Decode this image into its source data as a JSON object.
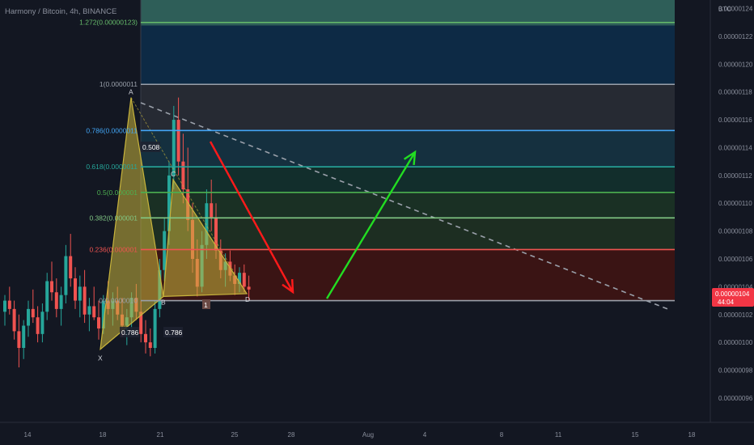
{
  "header": {
    "title": "Harmony / Bitcoin, 4h, BINANCE"
  },
  "price_axis": {
    "currency": "BTC",
    "last_price": "0.00000104",
    "countdown": "44:04",
    "last_price_color": "#f23645"
  },
  "colors": {
    "background": "#131722",
    "bull_candle": "#26a69a",
    "bear_candle": "#ef5350",
    "pattern_fill": "#c8b43c",
    "trendline": "#9aa0aa",
    "down_arrow": "#ff1a1a",
    "up_arrow": "#22dd22"
  },
  "chart_data": {
    "type": "candlestick",
    "title": "Harmony / Bitcoin, 4h, BINANCE",
    "y_unit": "BTC",
    "ylim": [
      9.52e-07,
      1.254e-06
    ],
    "x_ticks": [
      "14",
      "18",
      "21",
      "25",
      "28",
      "Aug",
      "4",
      "8",
      "11",
      "15",
      "18"
    ],
    "y_ticks": [
      "0.00000124",
      "0.00000122",
      "0.00000120",
      "0.00000118",
      "0.00000116",
      "0.00000114",
      "0.00000112",
      "0.00000110",
      "0.00000108",
      "0.00000106",
      "0.00000104",
      "0.00000102",
      "0.00000100",
      "0.00000098",
      "0.00000096"
    ],
    "fib_levels": [
      {
        "ratio": 1.272,
        "label": "1.272(0.00000123)",
        "price": 1.23e-06,
        "color": "#66bb6a"
      },
      {
        "ratio": 1,
        "label": "1(0.0000011",
        "price": 1.1855e-06,
        "color": "#9aa0aa"
      },
      {
        "ratio": 0.786,
        "label": "0.786(0.0000011",
        "price": 1.1523e-06,
        "color": "#42a5f5"
      },
      {
        "ratio": 0.618,
        "label": "0.618(0.0000011",
        "price": 1.1262e-06,
        "color": "#26a69a"
      },
      {
        "ratio": 0.5,
        "label": "0.5(0.000001",
        "price": 1.1078e-06,
        "color": "#4caf50"
      },
      {
        "ratio": 0.382,
        "label": "0.382(0.000001",
        "price": 1.0895e-06,
        "color": "#81c784"
      },
      {
        "ratio": 0.236,
        "label": "0.236(0.000001",
        "price": 1.0667e-06,
        "color": "#ef5350"
      },
      {
        "ratio": 0,
        "label": "0(0.0000010",
        "price": 1.03e-06,
        "color": "#9aa0aa"
      }
    ],
    "fib_zones": [
      {
        "from": 1.272,
        "to": 1.4,
        "color": "#2e5e58"
      },
      {
        "from": 1,
        "to": 1.272,
        "color": "#0d2a45"
      },
      {
        "from": 0.786,
        "to": 1,
        "color": "#262a33"
      },
      {
        "from": 0.618,
        "to": 0.786,
        "color": "#15303f"
      },
      {
        "from": 0.5,
        "to": 0.618,
        "color": "#122e2c"
      },
      {
        "from": 0.382,
        "to": 0.5,
        "color": "#1a3024"
      },
      {
        "from": 0.236,
        "to": 0.382,
        "color": "#1d2e22"
      },
      {
        "from": 0,
        "to": 0.236,
        "color": "#3a1414"
      }
    ],
    "harmonic_pattern": {
      "points": [
        {
          "name": "X",
          "price": 9.95e-07
        },
        {
          "name": "A",
          "price": 1.176e-06
        },
        {
          "name": "B",
          "price": 1.033e-06
        },
        {
          "name": "C",
          "price": 1.117e-06
        },
        {
          "name": "D",
          "price": 1.035e-06
        }
      ],
      "ratios": [
        "0.786",
        "0.786",
        "0.508"
      ],
      "marker": "1"
    },
    "candles": [
      {
        "o": 1.022,
        "h": 1.034,
        "l": 1.012,
        "c": 1.03
      },
      {
        "o": 1.03,
        "h": 1.04,
        "l": 1.02,
        "c": 1.024
      },
      {
        "o": 1.024,
        "h": 1.03,
        "l": 1.002,
        "c": 1.008
      },
      {
        "o": 1.008,
        "h": 1.02,
        "l": 0.982,
        "c": 0.996
      },
      {
        "o": 0.996,
        "h": 1.016,
        "l": 0.988,
        "c": 1.012
      },
      {
        "o": 1.012,
        "h": 1.03,
        "l": 1.004,
        "c": 1.024
      },
      {
        "o": 1.024,
        "h": 1.038,
        "l": 1.014,
        "c": 1.018
      },
      {
        "o": 1.018,
        "h": 1.026,
        "l": 1.0,
        "c": 1.006
      },
      {
        "o": 1.006,
        "h": 1.028,
        "l": 1.0,
        "c": 1.022
      },
      {
        "o": 1.022,
        "h": 1.05,
        "l": 1.016,
        "c": 1.044
      },
      {
        "o": 1.044,
        "h": 1.058,
        "l": 1.03,
        "c": 1.036
      },
      {
        "o": 1.036,
        "h": 1.046,
        "l": 1.018,
        "c": 1.024
      },
      {
        "o": 1.024,
        "h": 1.04,
        "l": 1.012,
        "c": 1.034
      },
      {
        "o": 1.034,
        "h": 1.07,
        "l": 1.028,
        "c": 1.062
      },
      {
        "o": 1.062,
        "h": 1.078,
        "l": 1.04,
        "c": 1.046
      },
      {
        "o": 1.046,
        "h": 1.054,
        "l": 1.024,
        "c": 1.03
      },
      {
        "o": 1.03,
        "h": 1.048,
        "l": 1.018,
        "c": 1.04
      },
      {
        "o": 1.04,
        "h": 1.052,
        "l": 1.014,
        "c": 1.02
      },
      {
        "o": 1.02,
        "h": 1.032,
        "l": 1.008,
        "c": 1.026
      },
      {
        "o": 1.026,
        "h": 1.04,
        "l": 1.016,
        "c": 1.018
      },
      {
        "o": 1.018,
        "h": 1.03,
        "l": 1.002,
        "c": 1.01
      },
      {
        "o": 1.01,
        "h": 1.034,
        "l": 1.006,
        "c": 1.03
      },
      {
        "o": 1.03,
        "h": 1.044,
        "l": 1.02,
        "c": 1.024
      },
      {
        "o": 1.024,
        "h": 1.036,
        "l": 1.012,
        "c": 1.03
      },
      {
        "o": 1.03,
        "h": 1.04,
        "l": 1.016,
        "c": 1.02
      },
      {
        "o": 1.02,
        "h": 1.032,
        "l": 1.004,
        "c": 1.012
      },
      {
        "o": 1.012,
        "h": 1.024,
        "l": 0.998,
        "c": 1.018
      },
      {
        "o": 1.018,
        "h": 1.036,
        "l": 1.01,
        "c": 1.032
      },
      {
        "o": 1.032,
        "h": 1.042,
        "l": 1.016,
        "c": 1.022
      },
      {
        "o": 1.022,
        "h": 1.03,
        "l": 1.0,
        "c": 1.006
      },
      {
        "o": 1.006,
        "h": 1.016,
        "l": 0.992,
        "c": 1.0
      },
      {
        "o": 1.0,
        "h": 1.01,
        "l": 0.99,
        "c": 0.996
      },
      {
        "o": 0.996,
        "h": 1.03,
        "l": 0.992,
        "c": 1.024
      },
      {
        "o": 1.024,
        "h": 1.06,
        "l": 1.018,
        "c": 1.052
      },
      {
        "o": 1.052,
        "h": 1.09,
        "l": 1.044,
        "c": 1.08
      },
      {
        "o": 1.08,
        "h": 1.13,
        "l": 1.07,
        "c": 1.12
      },
      {
        "o": 1.12,
        "h": 1.17,
        "l": 1.11,
        "c": 1.16
      },
      {
        "o": 1.16,
        "h": 1.176,
        "l": 1.12,
        "c": 1.13
      },
      {
        "o": 1.13,
        "h": 1.15,
        "l": 1.1,
        "c": 1.11
      },
      {
        "o": 1.11,
        "h": 1.14,
        "l": 1.08,
        "c": 1.088
      },
      {
        "o": 1.088,
        "h": 1.1,
        "l": 1.05,
        "c": 1.06
      },
      {
        "o": 1.06,
        "h": 1.074,
        "l": 1.033,
        "c": 1.04
      },
      {
        "o": 1.04,
        "h": 1.08,
        "l": 1.036,
        "c": 1.07
      },
      {
        "o": 1.07,
        "h": 1.11,
        "l": 1.06,
        "c": 1.1
      },
      {
        "o": 1.1,
        "h": 1.117,
        "l": 1.08,
        "c": 1.09
      },
      {
        "o": 1.09,
        "h": 1.1,
        "l": 1.06,
        "c": 1.066
      },
      {
        "o": 1.066,
        "h": 1.074,
        "l": 1.046,
        "c": 1.052
      },
      {
        "o": 1.052,
        "h": 1.064,
        "l": 1.04,
        "c": 1.058
      },
      {
        "o": 1.058,
        "h": 1.066,
        "l": 1.044,
        "c": 1.048
      },
      {
        "o": 1.048,
        "h": 1.056,
        "l": 1.034,
        "c": 1.042
      },
      {
        "o": 1.042,
        "h": 1.054,
        "l": 1.036,
        "c": 1.05
      },
      {
        "o": 1.05,
        "h": 1.056,
        "l": 1.036,
        "c": 1.04
      },
      {
        "o": 1.04,
        "h": 1.048,
        "l": 1.03,
        "c": 1.038
      }
    ],
    "annotations": [
      {
        "type": "arrow",
        "direction": "down",
        "color": "#ff1a1a"
      },
      {
        "type": "arrow",
        "direction": "up",
        "color": "#22dd22"
      },
      {
        "type": "dashed-trendline",
        "color": "#9aa0aa"
      }
    ]
  }
}
